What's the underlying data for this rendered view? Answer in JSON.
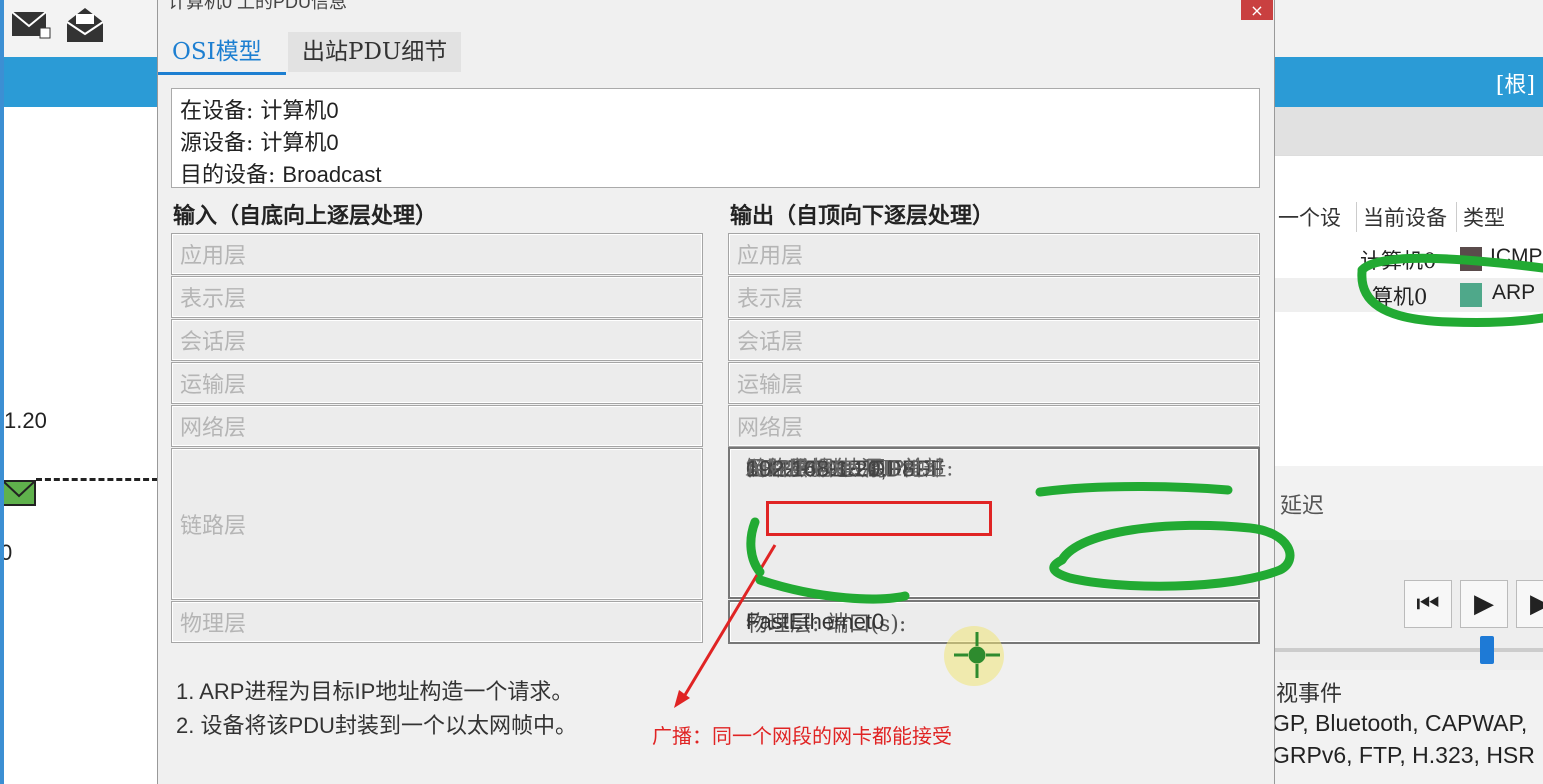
{
  "bg_left": {
    "labels": {
      "ip_fragment": "1.20",
      "zero": "0"
    },
    "tool_icons": [
      "envelope-simple-icon",
      "envelope-open-icon"
    ]
  },
  "bg_right": {
    "band_text": "[根]",
    "list_headers": [
      "一个设",
      "当前设备",
      "类型"
    ],
    "rows": [
      {
        "device": "计算机0",
        "color": "#5a4b4b",
        "type": "ICMP"
      },
      {
        "device": "算机0",
        "color": "#4fa88a",
        "type": "ARP"
      }
    ],
    "delay_label": "延迟",
    "controls": [
      "⏮",
      "▶",
      "▶"
    ],
    "visible_events_label": "视事件",
    "protocols": [
      "GP, Bluetooth, CAPWAP,",
      "GRPv6, FTP, H.323, HSR"
    ]
  },
  "dialog": {
    "title": "计算机0 上的PDU信息",
    "close": "×",
    "tabs": [
      {
        "label": "OSI模型",
        "active": true
      },
      {
        "label": "出站PDU细节",
        "active": false
      }
    ],
    "info": {
      "at_device_label": "在设备: ",
      "at_device": "计算机0",
      "source_label": "源设备: ",
      "source": "计算机0",
      "dest_label": "目的设备: ",
      "dest": "Broadcast"
    },
    "input_header": "输入（自底向上逐层处理）",
    "output_header": "输出（自顶向下逐层处理）",
    "input_layers": [
      "应用层",
      "表示层",
      "会话层",
      "运输层",
      "网络层",
      "链路层",
      "物理层"
    ],
    "output_layers": [
      "应用层",
      "表示层",
      "会话层",
      "运输层",
      "网络层"
    ],
    "link_layer_out": {
      "line1_prefix": "链路层: 以太网II首部 ",
      "line1_mac": "0002.4ABE.DD8D",
      "line2_prefix": "> ",
      "line2_mac": "FFFF.FFFF.FFFF",
      "line2_suffix": " ARP数据包 源IP地址:",
      "line3_ip1": "192.168.1.20,",
      "line3_mid": " 目的IP地址: ",
      "line3_ip2": "192.168.1.21"
    },
    "physical_out": {
      "prefix": "物理层: 端口(s): ",
      "port": "FastEthernet0"
    },
    "notes": [
      {
        "num": "1. ",
        "text_a": "ARP",
        "text_b": "进程为目标",
        "text_c": "IP",
        "text_d": "地址构造一个请求。"
      },
      {
        "num": "2. ",
        "text_a": "设备将该",
        "text_b": "PDU",
        "text_c": "封装到一个以太网帧中。",
        "text_d": ""
      }
    ],
    "annotation": "广播：同一个网段的网卡都能接受",
    "colors": {
      "accent": "#1d7fd1",
      "annotation": "#e02424",
      "highlight": "#22aa33"
    }
  }
}
